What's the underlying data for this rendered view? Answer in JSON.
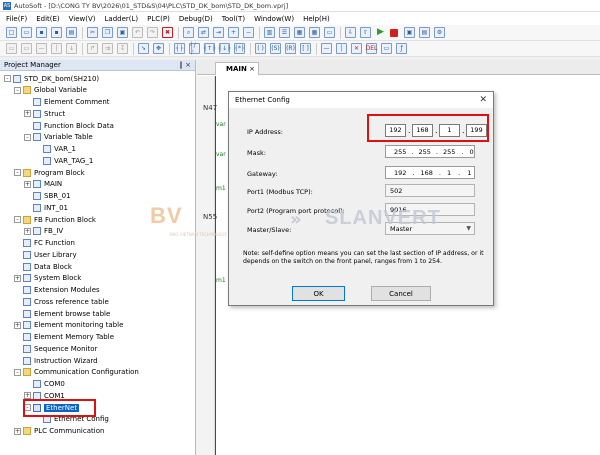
{
  "window": {
    "title": "AutoSoft - [D:\\CONG TY BV\\2026\\01_STD&S\\04\\PLC\\STD_DK_bom\\STD_DK_bom.vprj]"
  },
  "menu": [
    "File(F)",
    "Edit(E)",
    "View(V)",
    "Ladder(L)",
    "PLC(P)",
    "Debug(D)",
    "Tool(T)",
    "Window(W)",
    "Help(H)"
  ],
  "project_manager": {
    "title": "Project Manager",
    "pin": "‖",
    "close": "×",
    "tree": [
      {
        "label": "STD_DK_bom(SH210)",
        "indent": 0,
        "expander": "-",
        "icon": "monitor-icon"
      },
      {
        "label": "Global Variable",
        "indent": 1,
        "expander": "-",
        "icon": "folder-icon"
      },
      {
        "label": "Element Comment",
        "indent": 2,
        "expander": "",
        "icon": "document-icon"
      },
      {
        "label": "Struct",
        "indent": 2,
        "expander": "+",
        "icon": "document-icon"
      },
      {
        "label": "Function Block Data",
        "indent": 2,
        "expander": "",
        "icon": "document-icon"
      },
      {
        "label": "Variable Table",
        "indent": 2,
        "expander": "-",
        "icon": "document-icon"
      },
      {
        "label": "VAR_1",
        "indent": 3,
        "expander": "",
        "icon": "table-icon"
      },
      {
        "label": "VAR_TAG_1",
        "indent": 3,
        "expander": "",
        "icon": "table-icon"
      },
      {
        "label": "Program Block",
        "indent": 1,
        "expander": "-",
        "icon": "folder-icon"
      },
      {
        "label": "MAIN",
        "indent": 2,
        "expander": "+",
        "icon": "ladder-icon"
      },
      {
        "label": "SBR_01",
        "indent": 2,
        "expander": "",
        "icon": "ladder-icon"
      },
      {
        "label": "INT_01",
        "indent": 2,
        "expander": "",
        "icon": "ladder-icon"
      },
      {
        "label": "FB Function Block",
        "indent": 1,
        "expander": "-",
        "icon": "folder-icon"
      },
      {
        "label": "FB_IV",
        "indent": 2,
        "expander": "+",
        "icon": "block-icon"
      },
      {
        "label": "FC Function",
        "indent": 1,
        "expander": "",
        "icon": "document-icon"
      },
      {
        "label": "User Library",
        "indent": 1,
        "expander": "",
        "icon": "document-icon"
      },
      {
        "label": "Data Block",
        "indent": 1,
        "expander": "",
        "icon": "document-icon"
      },
      {
        "label": "System Block",
        "indent": 1,
        "expander": "+",
        "icon": "document-icon"
      },
      {
        "label": "Extension Modules",
        "indent": 1,
        "expander": "",
        "icon": "document-icon"
      },
      {
        "label": "Cross reference table",
        "indent": 1,
        "expander": "",
        "icon": "document-icon"
      },
      {
        "label": "Element browse table",
        "indent": 1,
        "expander": "",
        "icon": "document-icon"
      },
      {
        "label": "Element monitoring table",
        "indent": 1,
        "expander": "+",
        "icon": "document-icon"
      },
      {
        "label": "Element Memory Table",
        "indent": 1,
        "expander": "",
        "icon": "document-icon"
      },
      {
        "label": "Sequence Monitor",
        "indent": 1,
        "expander": "",
        "icon": "document-icon"
      },
      {
        "label": "Instruction Wizard",
        "indent": 1,
        "expander": "",
        "icon": "document-icon"
      },
      {
        "label": "Communication Configuration",
        "indent": 1,
        "expander": "-",
        "icon": "folder-icon"
      },
      {
        "label": "COM0",
        "indent": 2,
        "expander": "",
        "icon": "port-icon"
      },
      {
        "label": "COM1",
        "indent": 2,
        "expander": "+",
        "icon": "port-icon"
      },
      {
        "label": "EtherNet",
        "indent": 2,
        "expander": "-",
        "icon": "network-icon",
        "selected": true
      },
      {
        "label": "Ethernet Config",
        "indent": 3,
        "expander": "",
        "icon": "gear-icon"
      },
      {
        "label": "PLC Communication",
        "indent": 1,
        "expander": "+",
        "icon": "folder-icon"
      }
    ]
  },
  "editor": {
    "tab_label": "MAIN",
    "tab_close": "×",
    "rung_labels": [
      "N47",
      "N55"
    ],
    "var_labels": [
      "var",
      "var",
      "m1",
      "m1"
    ]
  },
  "dialog": {
    "title": "Ethernet Config",
    "close": "✕",
    "ip_label": "IP Address:",
    "ip": [
      "192",
      "168",
      "1",
      "199"
    ],
    "mask_label": "Mask:",
    "mask": [
      "255",
      "255",
      "255",
      "0"
    ],
    "gateway_label": "Gateway:",
    "gateway": [
      "192",
      "168",
      "1",
      "1"
    ],
    "port1_label": "Port1 (Modbus TCP):",
    "port1": "502",
    "port2_label": "Port2 (Program port protocol):",
    "port2": "9016",
    "master_label": "Master/Slave:",
    "master_value": "Master",
    "note": "Note: self-define option means you can set the last section of IP address, or it depends on the switch on the front panel, ranges from 1 to 254.",
    "ok": "OK",
    "cancel": "Cancel"
  },
  "watermark": {
    "left": "BV",
    "left_sub": "BAO VIETNAM TECHNOLOGY CO., LTD",
    "right": "SLANVERT"
  },
  "colors": {
    "highlight": "#e01010",
    "selection": "#0a64c8"
  }
}
